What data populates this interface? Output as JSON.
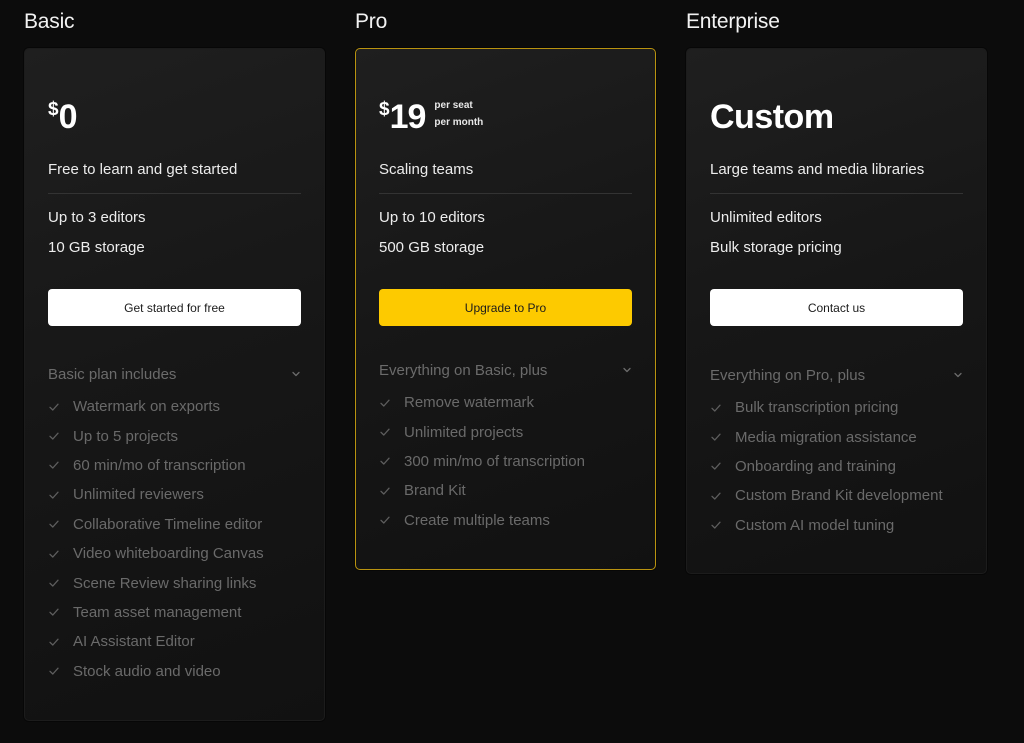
{
  "plans": [
    {
      "name": "Basic",
      "currency": "$",
      "amount": "0",
      "per_line1": "",
      "per_line2": "",
      "tagline": "Free to learn and get started",
      "specs": [
        "Up to 3 editors",
        "10 GB storage"
      ],
      "cta_label": "Get started for free",
      "features_heading": "Basic plan includes",
      "features": [
        "Watermark on exports",
        "Up to 5 projects",
        "60 min/mo of transcription",
        "Unlimited reviewers",
        "Collaborative Timeline editor",
        "Video whiteboarding Canvas",
        "Scene Review sharing links",
        "Team asset management",
        "AI Assistant Editor",
        "Stock audio and video"
      ]
    },
    {
      "name": "Pro",
      "currency": "$",
      "amount": "19",
      "per_line1": "per seat",
      "per_line2": "per month",
      "tagline": "Scaling teams",
      "specs": [
        "Up to 10 editors",
        "500 GB storage"
      ],
      "cta_label": "Upgrade to Pro",
      "features_heading": "Everything on Basic, plus",
      "features": [
        "Remove watermark",
        "Unlimited projects",
        "300 min/mo of transcription",
        "Brand Kit",
        "Create multiple teams"
      ]
    },
    {
      "name": "Enterprise",
      "currency": "",
      "amount": "Custom",
      "per_line1": "",
      "per_line2": "",
      "tagline": "Large teams and media libraries",
      "specs": [
        "Unlimited editors",
        "Bulk storage pricing"
      ],
      "cta_label": "Contact us",
      "features_heading": "Everything on Pro, plus",
      "features": [
        "Bulk transcription pricing",
        "Media migration assistance",
        "Onboarding and training",
        "Custom Brand Kit development",
        "Custom AI model tuning"
      ]
    }
  ],
  "colors": {
    "accent": "#fdca00",
    "highlight_border": "#b99310",
    "background": "#0c0c0c"
  },
  "icons": {
    "feature_bullet": "check-icon",
    "features_toggle": "chevron-down-icon"
  }
}
